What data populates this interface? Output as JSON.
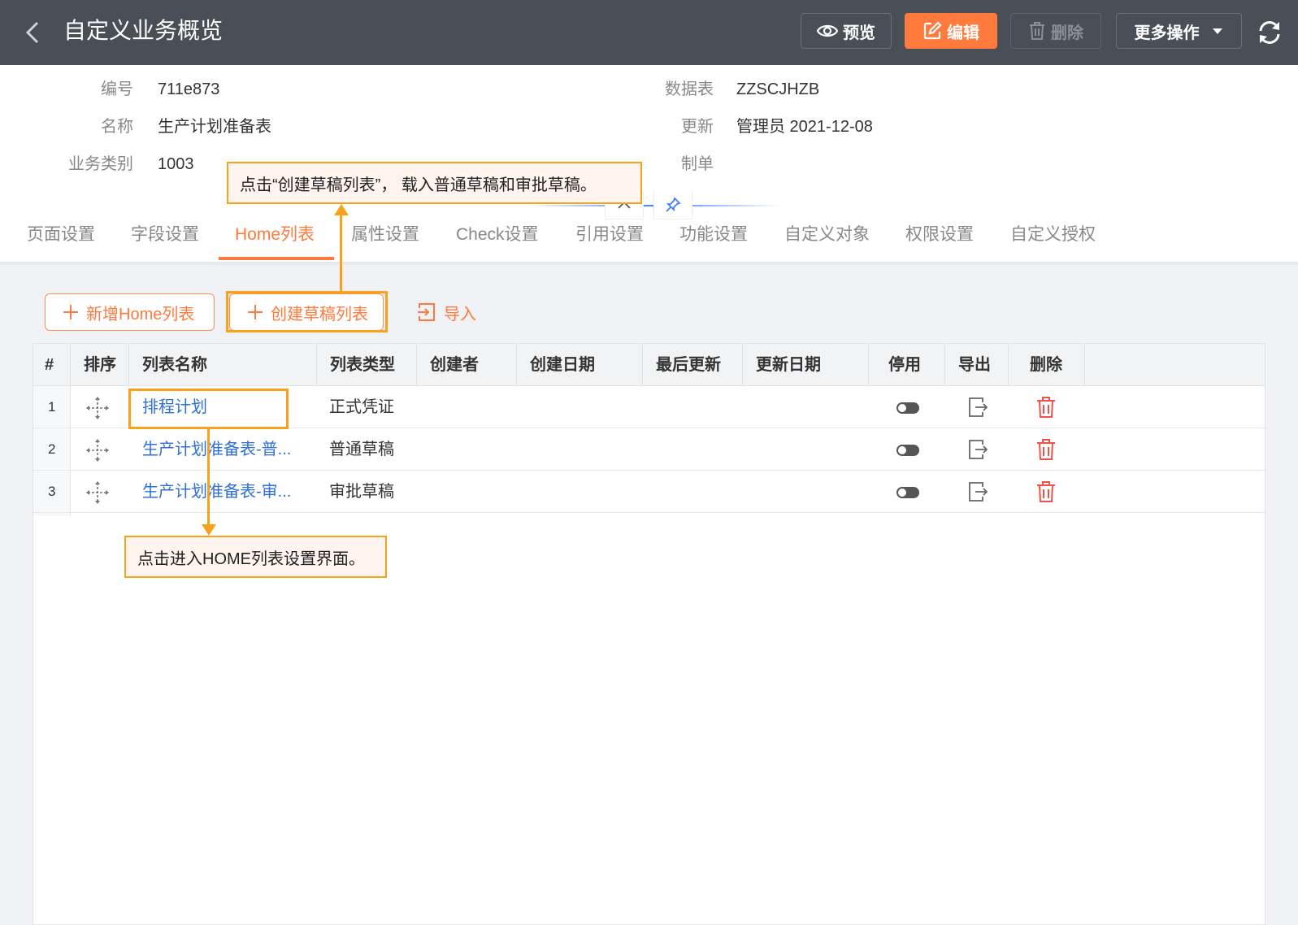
{
  "header": {
    "title": "自定义业务概览",
    "preview_label": "预览",
    "edit_label": "编辑",
    "delete_label": "删除",
    "more_label": "更多操作"
  },
  "info": {
    "code_label": "编号",
    "code_value": "711e873",
    "name_label": "名称",
    "name_value": "生产计划准备表",
    "category_label": "业务类别",
    "category_value": "1003",
    "table_label": "数据表",
    "table_value": "ZZSCJHZB",
    "update_label": "更新",
    "update_value": "管理员 2021-12-08",
    "maker_label": "制单"
  },
  "tabs": [
    "页面设置",
    "字段设置",
    "Home列表",
    "属性设置",
    "Check设置",
    "引用设置",
    "功能设置",
    "自定义对象",
    "权限设置",
    "自定义授权"
  ],
  "toolbar": {
    "new_label": "新增Home列表",
    "draft_label": "创建草稿列表",
    "import_label": "导入"
  },
  "table": {
    "columns": [
      "#",
      "排序",
      "列表名称",
      "列表类型",
      "创建者",
      "创建日期",
      "最后更新",
      "更新日期",
      "停用",
      "导出",
      "删除"
    ],
    "rows": [
      {
        "index": "1",
        "name": "排程计划",
        "type": "正式凭证"
      },
      {
        "index": "2",
        "name": "生产计划准备表-普...",
        "type": "普通草稿"
      },
      {
        "index": "3",
        "name": "生产计划准备表-审...",
        "type": "审批草稿"
      }
    ]
  },
  "annotations": {
    "draft_tip": "点击“创建草稿列表”， 载入普通草稿和审批草稿。",
    "home_tip": "点击进入HOME列表设置界面。"
  },
  "colors": {
    "header_bg": "#4a4f57",
    "accent": "#ff7a3d",
    "link": "#2f6fd6",
    "annotation": "#f7a21b",
    "delete_icon": "#f0524a"
  }
}
